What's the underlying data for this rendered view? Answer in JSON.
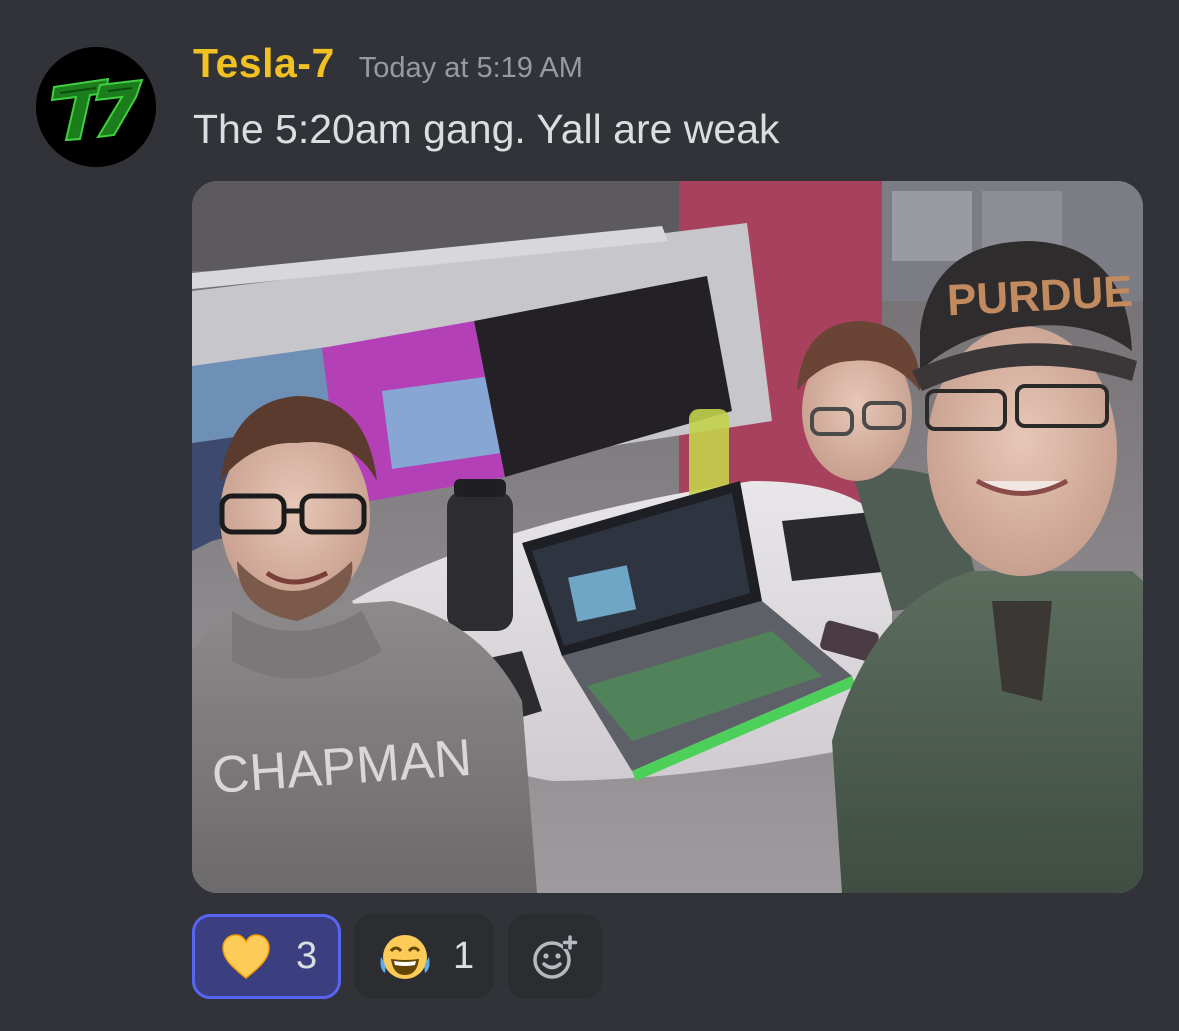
{
  "message": {
    "author": "Tesla-7",
    "author_color": "#f0c121",
    "timestamp": "Today at 5:19 AM",
    "text": "The 5:20am gang. Yall are weak",
    "avatar_text": "T7"
  },
  "attachment": {
    "type": "photo",
    "cap_text": "PURDUE",
    "hoodie_text": "CHAPMAN"
  },
  "reactions": [
    {
      "emoji": "yellow-heart",
      "count": "3",
      "active": true
    },
    {
      "emoji": "face-with-tears-of-joy",
      "count": "1",
      "active": false
    },
    {
      "emoji": "add-reaction",
      "count": "",
      "active": false
    }
  ],
  "colors": {
    "background": "#313338",
    "reaction_active_bg": "#3b3f80",
    "reaction_active_border": "#5865f2",
    "reaction_bg": "#2b2d31"
  }
}
